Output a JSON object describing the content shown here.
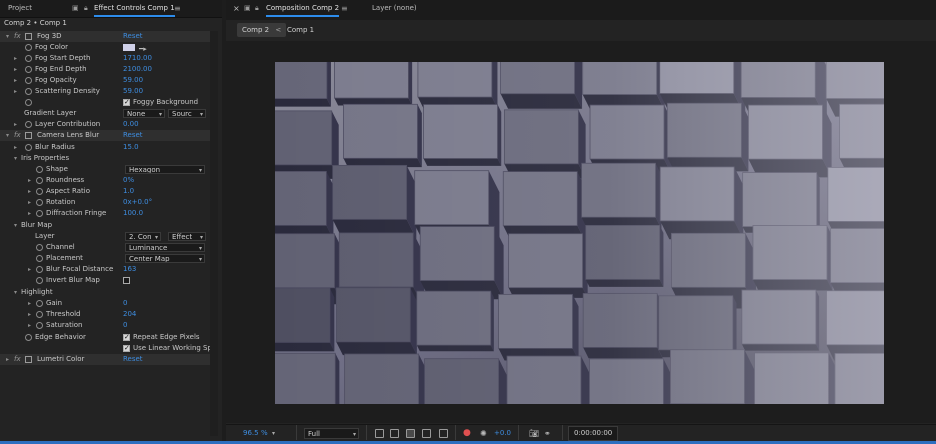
{
  "left_tabs": {
    "project": "Project",
    "effect_controls": "Effect Controls Comp 1",
    "menu": "≡"
  },
  "comp_path": "Comp 2 • Comp 1",
  "fog3d": {
    "name": "Fog 3D",
    "reset": "Reset",
    "fog_color_label": "Fog Color",
    "fog_color": "#cfd0e8",
    "start_depth_label": "Fog Start Depth",
    "start_depth": "1710.00",
    "end_depth_label": "Fog End Depth",
    "end_depth": "2100.00",
    "opacity_label": "Fog Opacity",
    "opacity": "59.00",
    "scattering_label": "Scattering Density",
    "scattering": "59.00",
    "foggy_bg_label": "Foggy Background",
    "gradient_layer_label": "Gradient Layer",
    "gradient_layer": "None",
    "gradient_source": "Sourc",
    "layer_contribution_label": "Layer Contribution",
    "layer_contribution": "0.00"
  },
  "lens_blur": {
    "name": "Camera Lens Blur",
    "reset": "Reset",
    "blur_radius_label": "Blur Radius",
    "blur_radius": "15.0",
    "iris_label": "Iris Properties",
    "shape_label": "Shape",
    "shape": "Hexagon",
    "roundness_label": "Roundness",
    "roundness": "0%",
    "aspect_label": "Aspect Ratio",
    "aspect": "1.0",
    "rotation_label": "Rotation",
    "rotation": "0x+0.0°",
    "diffraction_label": "Diffraction Fringe",
    "diffraction": "100.0",
    "blur_map_label": "Blur Map",
    "layer_label": "Layer",
    "layer": "2. Con",
    "layer_mode": "Effect",
    "channel_label": "Channel",
    "channel": "Luminance",
    "placement_label": "Placement",
    "placement": "Center Map",
    "focal_label": "Blur Focal Distance",
    "focal": "163",
    "invert_label": "Invert Blur Map",
    "highlight_label": "Highlight",
    "gain_label": "Gain",
    "gain": "0",
    "threshold_label": "Threshold",
    "threshold": "204",
    "saturation_label": "Saturation",
    "saturation": "0",
    "edge_label": "Edge Behavior",
    "edge_repeat": "Repeat Edge Pixels",
    "linear_label": "Use Linear Working Sp"
  },
  "lumetri": {
    "name": "Lumetri Color",
    "reset": "Reset"
  },
  "right_tabs": {
    "close": "×",
    "composition": "Composition Comp 2",
    "menu": "≡",
    "layer": "Layer (none)"
  },
  "subtabs": {
    "comp2": "Comp 2",
    "chevron": "<",
    "comp1": "Comp 1"
  },
  "bottom": {
    "zoom": "96.5",
    "zoom_unit": "%",
    "resolution": "Full",
    "exposure": "+0.0",
    "timecode": "0:00:00:00"
  },
  "colors": {
    "accent": "#2d8ceb",
    "value_blue": "#3e8de0"
  }
}
